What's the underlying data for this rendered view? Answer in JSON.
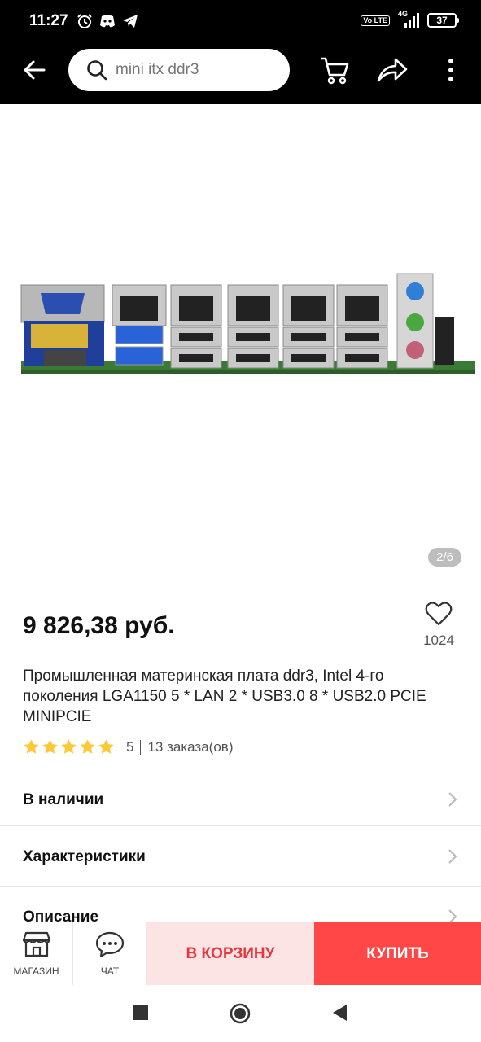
{
  "status_bar": {
    "time": "11:27",
    "network": "4G",
    "volte": "Vo LTE",
    "battery": "37"
  },
  "header": {
    "search_placeholder": "mini itx ddr3"
  },
  "gallery": {
    "counter": "2/6"
  },
  "product": {
    "price": "9 826,38 руб.",
    "favorites_count": "1024",
    "title": "Промышленная материнская плата ddr3, Intel 4-го поколения LGA1150 5 * LAN 2 * USB3.0 8 * USB2.0 PCIE MINIPCIE",
    "rating_score": "5",
    "rating_stars": 5,
    "orders": "13 заказа(ов)"
  },
  "sections": [
    {
      "label": "В наличии"
    },
    {
      "label": "Характеристики"
    },
    {
      "label": "Описание"
    }
  ],
  "action_bar": {
    "store_label": "МАГАЗИН",
    "chat_label": "ЧАТ",
    "cart_label": "В КОРЗИНУ",
    "buy_label": "КУПИТЬ"
  },
  "colors": {
    "accent": "#ff4747",
    "cart_bg": "#fde4e4",
    "star": "#ffc835"
  }
}
